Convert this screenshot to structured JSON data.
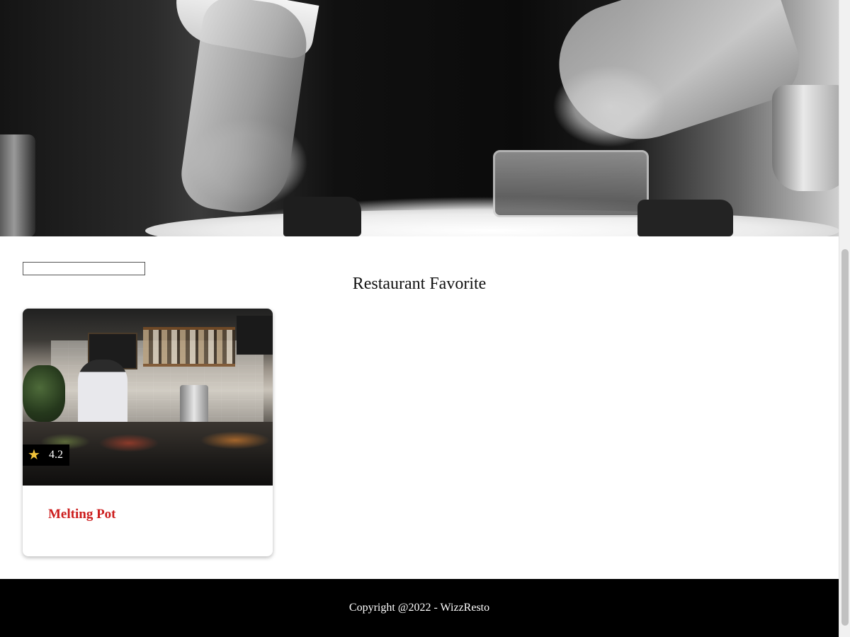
{
  "hero": {
    "image_description": ""
  },
  "search": {
    "value": "",
    "placeholder": ""
  },
  "section": {
    "title": "Restaurant Favorite"
  },
  "restaurants": [
    {
      "name": "Melting Pot",
      "rating": "4.2",
      "rating_icon": "star-icon"
    }
  ],
  "footer": {
    "copyright": "Copyright @2022 - WizzResto"
  },
  "colors": {
    "footer_bg": "#000000",
    "restaurant_name": "#cc1c1c",
    "star": "#f0c239"
  }
}
